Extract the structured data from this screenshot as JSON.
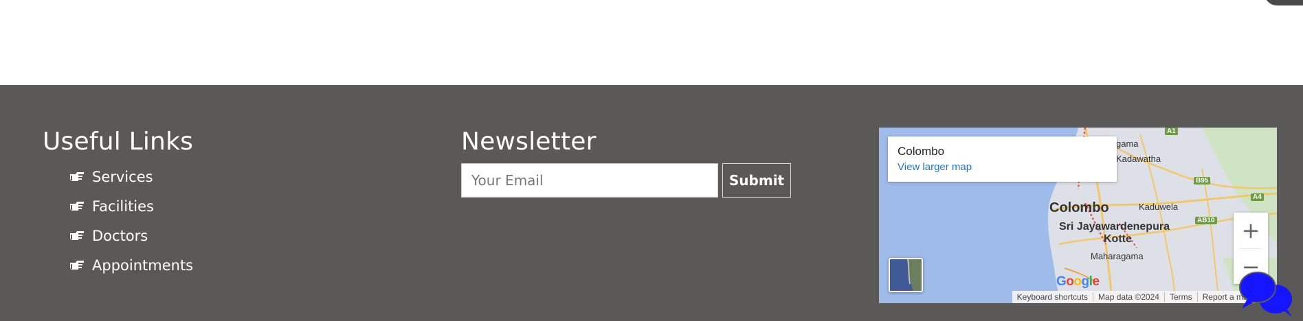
{
  "useful_links": {
    "heading": "Useful Links",
    "items": [
      {
        "label": "Services"
      },
      {
        "label": "Facilities"
      },
      {
        "label": "Doctors"
      },
      {
        "label": "Appointments"
      }
    ]
  },
  "newsletter": {
    "heading": "Newsletter",
    "email_placeholder": "Your Email",
    "submit_label": "Submit"
  },
  "map": {
    "place_title": "Colombo",
    "view_larger_label": "View larger map",
    "zoom_in_label": "+",
    "zoom_out_label": "−",
    "labels": {
      "colombo": "Colombo",
      "sri_jaya": "Sri Jayawardenepura",
      "kotte": "Kotte",
      "kadawatha": "Kadawatha",
      "kaduwela": "Kaduwela",
      "maharagama": "Maharagama",
      "gama": "gama"
    },
    "road_badges": [
      "A1",
      "B95",
      "A4",
      "AB10"
    ],
    "google_logo": "Google",
    "attribution": {
      "keyboard": "Keyboard shortcuts",
      "map_data": "Map data ©2024",
      "terms": "Terms",
      "report": "Report a map error"
    }
  },
  "colors": {
    "footer_bg": "#5b5957",
    "chat_blue": "#1515ff",
    "map_link": "#1a73e8"
  }
}
